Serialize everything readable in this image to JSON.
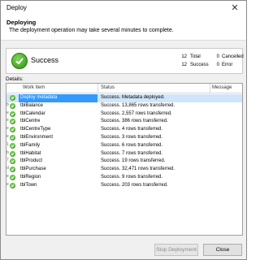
{
  "window": {
    "title": "Deploy",
    "close_glyph": "✕"
  },
  "header": {
    "title": "Deploying",
    "subtitle": "The deployment operation may take several minutes to complete."
  },
  "summary": {
    "status": "Success",
    "stats": [
      {
        "value": "12",
        "label": "Total"
      },
      {
        "value": "0",
        "label": "Cancelled"
      },
      {
        "value": "12",
        "label": "Success"
      },
      {
        "value": "0",
        "label": "Error"
      }
    ]
  },
  "details": {
    "label": "Details:",
    "columns": {
      "work_item": "Work Item",
      "status": "Status",
      "message": "Message"
    },
    "rows": [
      {
        "item": "Deploy metadata",
        "status": "Success. Metadata deployed.",
        "num": "",
        "selected": true
      },
      {
        "item": "tblBalance",
        "status": "Success. 13,865 rows transferred.",
        "num": "b"
      },
      {
        "item": "tblCalendar",
        "status": "Success. 2,557 rows transferred.",
        "num": "e"
      },
      {
        "item": "tblCentre",
        "status": "Success. 386 rows transferred.",
        "num": "e"
      },
      {
        "item": "tblCentreType",
        "status": "Success. 4 rows transferred.",
        "num": "e"
      },
      {
        "item": "tblEnvironment",
        "status": "Success. 3 rows transferred.",
        "num": "e"
      },
      {
        "item": "tblFamily",
        "status": "Success. 6 rows transferred.",
        "num": "1"
      },
      {
        "item": "tblHabitat",
        "status": "Success. 7 rows transferred.",
        "num": "b"
      },
      {
        "item": "tblProduct",
        "status": "Success. 19 rows transferred.",
        "num": "7"
      },
      {
        "item": "tblPurchase",
        "status": "Success. 32,471 rows transferred.",
        "num": "d"
      },
      {
        "item": "tblRegion",
        "status": "Success. 9 rows transferred.",
        "num": "e"
      },
      {
        "item": "tblTown",
        "status": "Success. 203 rows transferred.",
        "num": "e"
      }
    ]
  },
  "buttons": {
    "stop": "Stop Deployment",
    "close": "Close"
  }
}
